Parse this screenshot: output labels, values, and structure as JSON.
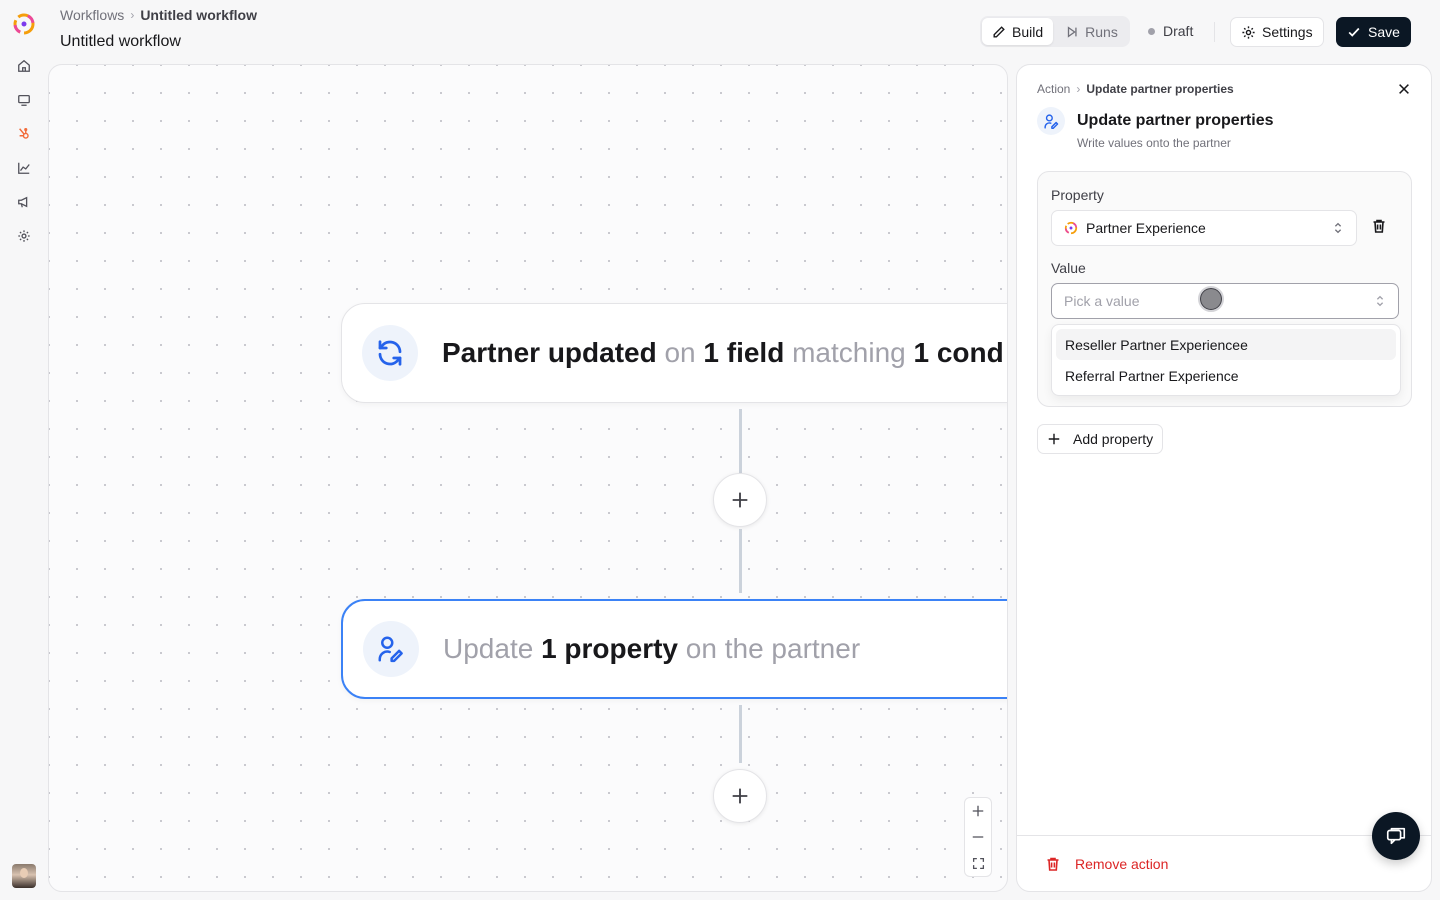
{
  "header": {
    "breadcrumb_root": "Workflows",
    "breadcrumb_current": "Untitled workflow",
    "title": "Untitled workflow",
    "tabs": {
      "build": "Build",
      "runs": "Runs"
    },
    "status": "Draft",
    "settings_label": "Settings",
    "save_label": "Save"
  },
  "canvas": {
    "trigger": {
      "p1": "Partner updated",
      "p2": " on ",
      "p3": "1 field",
      "p4": " matching ",
      "p5": "1 cond"
    },
    "action": {
      "p1": "Update ",
      "p2": "1 property",
      "p3": " on the partner"
    }
  },
  "panel": {
    "crumb_root": "Action",
    "crumb_current": "Update partner properties",
    "title": "Update partner properties",
    "subtitle": "Write values onto the partner",
    "property_label": "Property",
    "property_value": "Partner Experience",
    "value_label": "Value",
    "value_placeholder": "Pick a value",
    "options": [
      "Reseller Partner Experiencee",
      "Referral Partner Experience"
    ],
    "add_property_label": "Add property",
    "remove_action_label": "Remove action"
  },
  "colors": {
    "accent": "#2563eb",
    "primary_button": "#0b1724",
    "danger": "#dc2626"
  }
}
